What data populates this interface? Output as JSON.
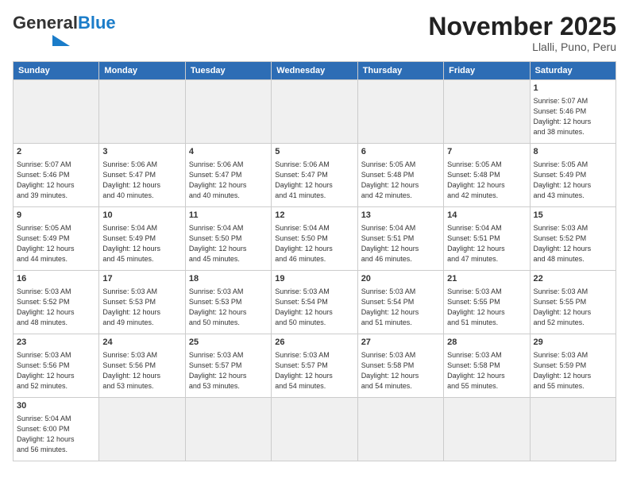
{
  "logo": {
    "general": "General",
    "blue": "Blue"
  },
  "header": {
    "month": "November 2025",
    "location": "Llalli, Puno, Peru"
  },
  "weekdays": [
    "Sunday",
    "Monday",
    "Tuesday",
    "Wednesday",
    "Thursday",
    "Friday",
    "Saturday"
  ],
  "weeks": [
    [
      {
        "day": "",
        "info": ""
      },
      {
        "day": "",
        "info": ""
      },
      {
        "day": "",
        "info": ""
      },
      {
        "day": "",
        "info": ""
      },
      {
        "day": "",
        "info": ""
      },
      {
        "day": "",
        "info": ""
      },
      {
        "day": "1",
        "info": "Sunrise: 5:07 AM\nSunset: 5:46 PM\nDaylight: 12 hours\nand 38 minutes."
      }
    ],
    [
      {
        "day": "2",
        "info": "Sunrise: 5:07 AM\nSunset: 5:46 PM\nDaylight: 12 hours\nand 39 minutes."
      },
      {
        "day": "3",
        "info": "Sunrise: 5:06 AM\nSunset: 5:47 PM\nDaylight: 12 hours\nand 40 minutes."
      },
      {
        "day": "4",
        "info": "Sunrise: 5:06 AM\nSunset: 5:47 PM\nDaylight: 12 hours\nand 40 minutes."
      },
      {
        "day": "5",
        "info": "Sunrise: 5:06 AM\nSunset: 5:47 PM\nDaylight: 12 hours\nand 41 minutes."
      },
      {
        "day": "6",
        "info": "Sunrise: 5:05 AM\nSunset: 5:48 PM\nDaylight: 12 hours\nand 42 minutes."
      },
      {
        "day": "7",
        "info": "Sunrise: 5:05 AM\nSunset: 5:48 PM\nDaylight: 12 hours\nand 42 minutes."
      },
      {
        "day": "8",
        "info": "Sunrise: 5:05 AM\nSunset: 5:49 PM\nDaylight: 12 hours\nand 43 minutes."
      }
    ],
    [
      {
        "day": "9",
        "info": "Sunrise: 5:05 AM\nSunset: 5:49 PM\nDaylight: 12 hours\nand 44 minutes."
      },
      {
        "day": "10",
        "info": "Sunrise: 5:04 AM\nSunset: 5:49 PM\nDaylight: 12 hours\nand 45 minutes."
      },
      {
        "day": "11",
        "info": "Sunrise: 5:04 AM\nSunset: 5:50 PM\nDaylight: 12 hours\nand 45 minutes."
      },
      {
        "day": "12",
        "info": "Sunrise: 5:04 AM\nSunset: 5:50 PM\nDaylight: 12 hours\nand 46 minutes."
      },
      {
        "day": "13",
        "info": "Sunrise: 5:04 AM\nSunset: 5:51 PM\nDaylight: 12 hours\nand 46 minutes."
      },
      {
        "day": "14",
        "info": "Sunrise: 5:04 AM\nSunset: 5:51 PM\nDaylight: 12 hours\nand 47 minutes."
      },
      {
        "day": "15",
        "info": "Sunrise: 5:03 AM\nSunset: 5:52 PM\nDaylight: 12 hours\nand 48 minutes."
      }
    ],
    [
      {
        "day": "16",
        "info": "Sunrise: 5:03 AM\nSunset: 5:52 PM\nDaylight: 12 hours\nand 48 minutes."
      },
      {
        "day": "17",
        "info": "Sunrise: 5:03 AM\nSunset: 5:53 PM\nDaylight: 12 hours\nand 49 minutes."
      },
      {
        "day": "18",
        "info": "Sunrise: 5:03 AM\nSunset: 5:53 PM\nDaylight: 12 hours\nand 50 minutes."
      },
      {
        "day": "19",
        "info": "Sunrise: 5:03 AM\nSunset: 5:54 PM\nDaylight: 12 hours\nand 50 minutes."
      },
      {
        "day": "20",
        "info": "Sunrise: 5:03 AM\nSunset: 5:54 PM\nDaylight: 12 hours\nand 51 minutes."
      },
      {
        "day": "21",
        "info": "Sunrise: 5:03 AM\nSunset: 5:55 PM\nDaylight: 12 hours\nand 51 minutes."
      },
      {
        "day": "22",
        "info": "Sunrise: 5:03 AM\nSunset: 5:55 PM\nDaylight: 12 hours\nand 52 minutes."
      }
    ],
    [
      {
        "day": "23",
        "info": "Sunrise: 5:03 AM\nSunset: 5:56 PM\nDaylight: 12 hours\nand 52 minutes."
      },
      {
        "day": "24",
        "info": "Sunrise: 5:03 AM\nSunset: 5:56 PM\nDaylight: 12 hours\nand 53 minutes."
      },
      {
        "day": "25",
        "info": "Sunrise: 5:03 AM\nSunset: 5:57 PM\nDaylight: 12 hours\nand 53 minutes."
      },
      {
        "day": "26",
        "info": "Sunrise: 5:03 AM\nSunset: 5:57 PM\nDaylight: 12 hours\nand 54 minutes."
      },
      {
        "day": "27",
        "info": "Sunrise: 5:03 AM\nSunset: 5:58 PM\nDaylight: 12 hours\nand 54 minutes."
      },
      {
        "day": "28",
        "info": "Sunrise: 5:03 AM\nSunset: 5:58 PM\nDaylight: 12 hours\nand 55 minutes."
      },
      {
        "day": "29",
        "info": "Sunrise: 5:03 AM\nSunset: 5:59 PM\nDaylight: 12 hours\nand 55 minutes."
      }
    ],
    [
      {
        "day": "30",
        "info": "Sunrise: 5:04 AM\nSunset: 6:00 PM\nDaylight: 12 hours\nand 56 minutes."
      },
      {
        "day": "",
        "info": ""
      },
      {
        "day": "",
        "info": ""
      },
      {
        "day": "",
        "info": ""
      },
      {
        "day": "",
        "info": ""
      },
      {
        "day": "",
        "info": ""
      },
      {
        "day": "",
        "info": ""
      }
    ]
  ]
}
